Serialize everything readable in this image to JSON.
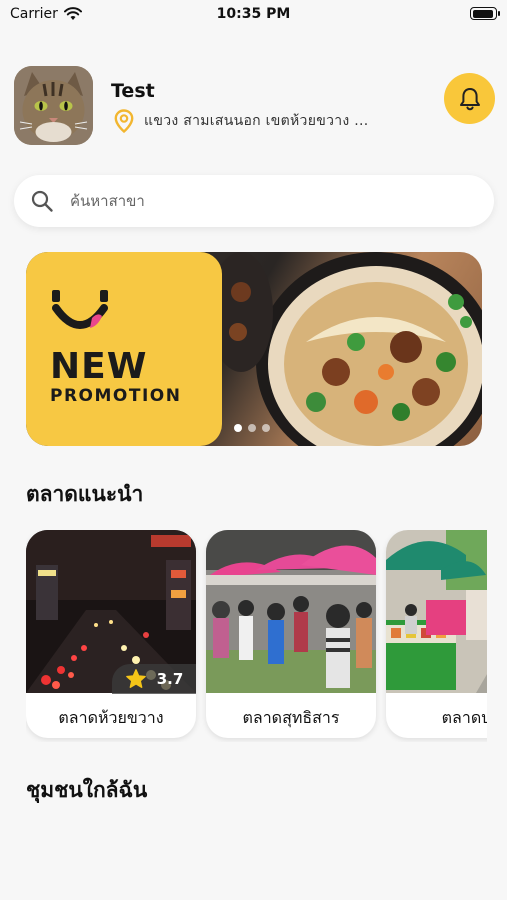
{
  "status_bar": {
    "carrier": "Carrier",
    "time": "10:35 PM"
  },
  "profile": {
    "name": "Test",
    "location": "แขวง สามเสนนอก เขตห้วยขวาง ..."
  },
  "search": {
    "placeholder": "ค้นหาสาขา"
  },
  "banner": {
    "title": "NEW",
    "subtitle": "PROMOTION",
    "page_count": 3,
    "active_page": 1
  },
  "sections": {
    "recommended_markets": "ตลาดแนะนำ",
    "nearby_communities": "ชุมชนใกล้ฉัน"
  },
  "markets": [
    {
      "name": "ตลาดห้วยขวาง",
      "rating": "3.7"
    },
    {
      "name": "ตลาดสุทธิสาร"
    },
    {
      "name": "ตลาดบา"
    }
  ],
  "colors": {
    "accent": "#f9c73a",
    "banner_yellow": "#f7c843",
    "star": "#f5c518"
  },
  "icons": [
    "wifi-icon",
    "battery-icon",
    "location-pin-icon",
    "bell-icon",
    "search-icon",
    "star-icon"
  ]
}
